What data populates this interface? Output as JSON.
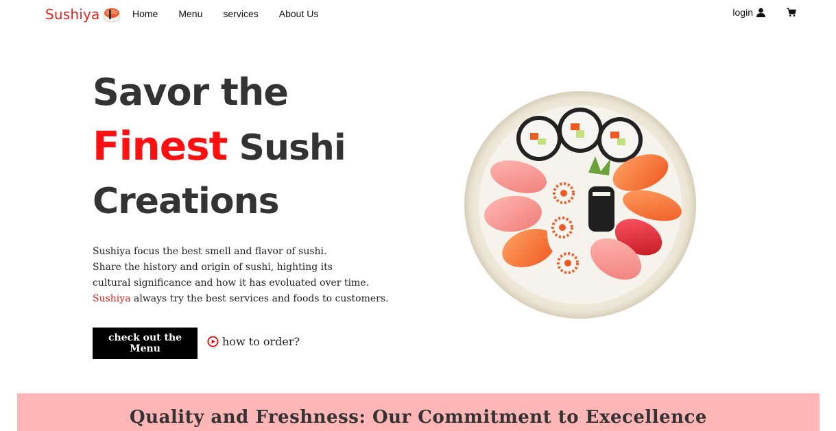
{
  "brand": {
    "name": "Sushiya",
    "logo_icon": "sushi-logo-icon",
    "color": "#e8201c"
  },
  "nav": {
    "links": [
      "Home",
      "Menu",
      "services",
      "About Us"
    ],
    "login_label": "login",
    "login_icon": "user-icon",
    "cart_icon": "cart-icon"
  },
  "hero": {
    "title_line1": "Savor the",
    "title_accent": "Finest",
    "title_line2_rest": " Sushi",
    "title_line3": "Creations",
    "accent_color": "#ff1010",
    "description": [
      "Sushiya focus the best smell and flavor of sushi.",
      "Share the history and origin of sushi, highting its",
      "cultural significance and how it has evoluated over time."
    ],
    "description_last_highlight": "Sushiya",
    "description_last_rest": " always try the best services and foods to customers.",
    "cta_label": "check out the Menu",
    "howto_label": "how to order?",
    "howto_icon": "play-circle-icon"
  },
  "banner": {
    "title": "Quality and Freshness: Our Commitment to Execellence",
    "background": "#ffb6b6"
  }
}
